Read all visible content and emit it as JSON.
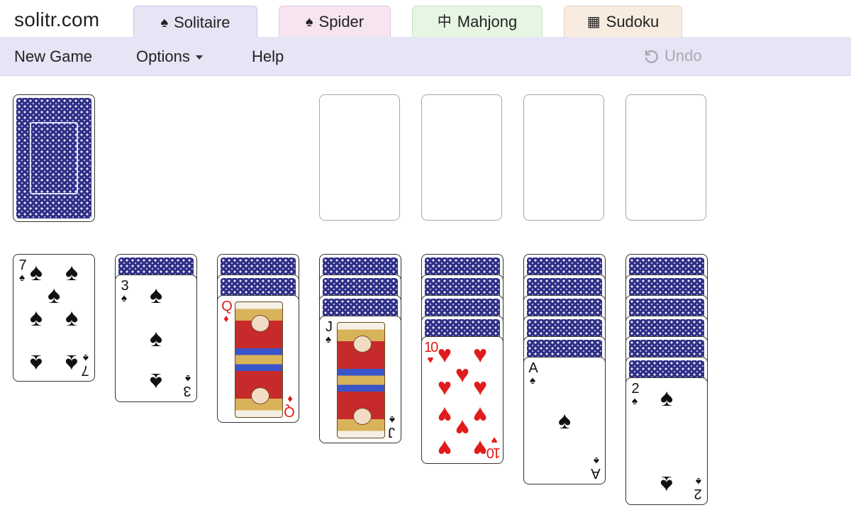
{
  "site": {
    "logo": "solitr.com"
  },
  "tabs": [
    {
      "label": "Solitaire",
      "icon": "♠",
      "icon_name": "spade-icon",
      "active": true
    },
    {
      "label": "Spider",
      "icon": "♠",
      "icon_name": "spade-icon"
    },
    {
      "label": "Mahjong",
      "icon": "中",
      "icon_name": "mahjong-tile-icon"
    },
    {
      "label": "Sudoku",
      "icon": "▦",
      "icon_name": "grid-icon"
    }
  ],
  "menu": {
    "new_game": "New Game",
    "options": "Options",
    "help": "Help",
    "undo": "Undo",
    "undo_enabled": false
  },
  "colors": {
    "menubar": "#e6e4f5",
    "card_back": "#2f2f86",
    "red_suit": "#e11b1b"
  },
  "game": {
    "stock": {
      "face_down": 1
    },
    "waste": [],
    "foundations": [
      [],
      [],
      [],
      []
    ],
    "tableau": [
      {
        "face_down": 0,
        "face_up": [
          {
            "rank": "7",
            "suit": "♠",
            "suit_name": "spades"
          }
        ]
      },
      {
        "face_down": 1,
        "face_up": [
          {
            "rank": "3",
            "suit": "♠",
            "suit_name": "spades"
          }
        ]
      },
      {
        "face_down": 2,
        "face_up": [
          {
            "rank": "Q",
            "suit": "♦",
            "suit_name": "diamonds"
          }
        ]
      },
      {
        "face_down": 3,
        "face_up": [
          {
            "rank": "J",
            "suit": "♠",
            "suit_name": "spades"
          }
        ]
      },
      {
        "face_down": 4,
        "face_up": [
          {
            "rank": "10",
            "suit": "♥",
            "suit_name": "hearts"
          }
        ]
      },
      {
        "face_down": 5,
        "face_up": [
          {
            "rank": "A",
            "suit": "♠",
            "suit_name": "spades"
          }
        ]
      },
      {
        "face_down": 6,
        "face_up": [
          {
            "rank": "2",
            "suit": "♠",
            "suit_name": "spades"
          }
        ]
      }
    ]
  }
}
